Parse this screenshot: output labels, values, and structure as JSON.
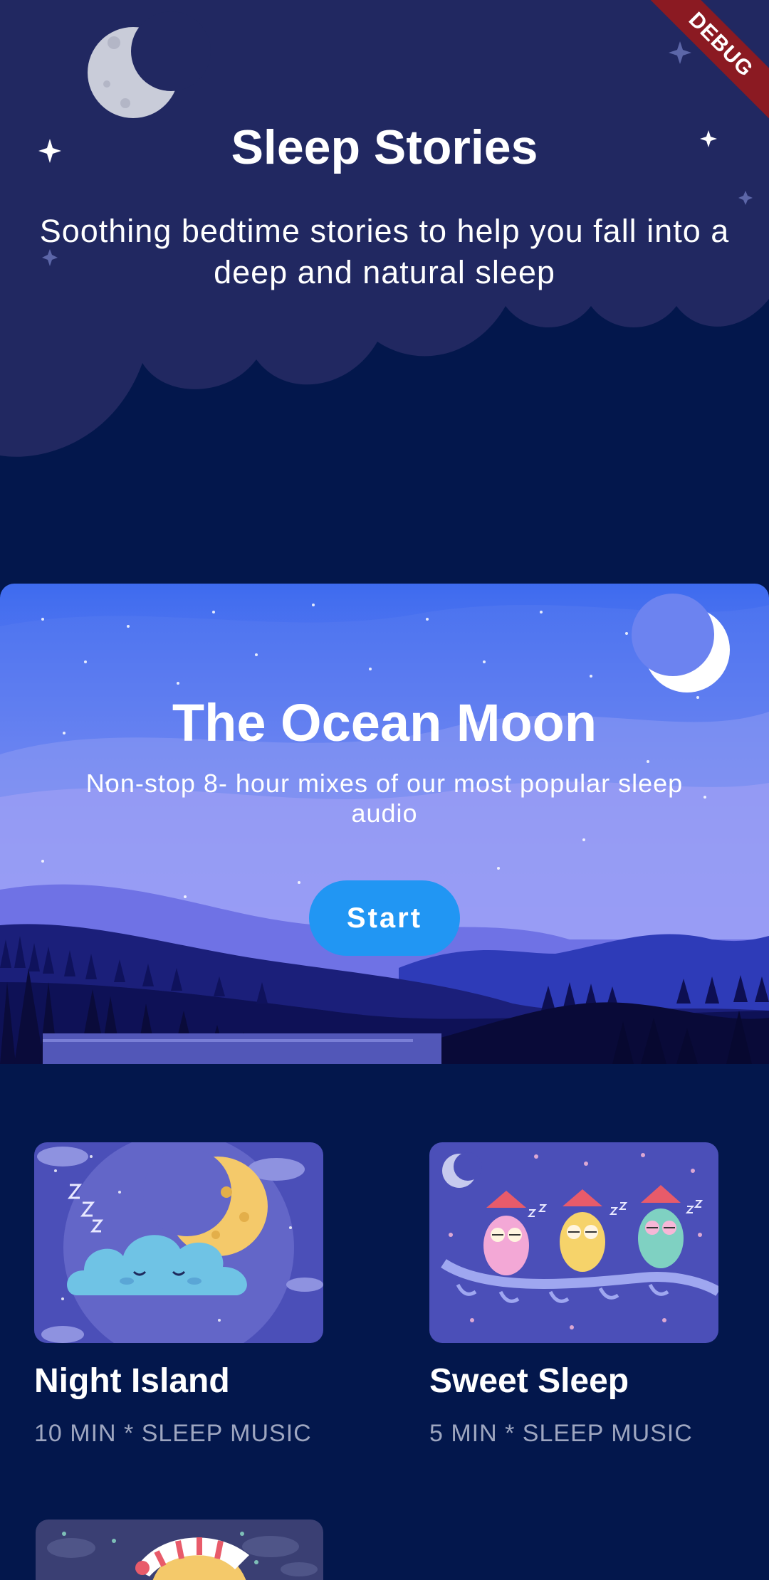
{
  "header": {
    "title": "Sleep Stories",
    "subtitle": "Soothing bedtime stories to help you fall into a deep and natural sleep"
  },
  "debug_banner": "DEBUG",
  "featured": {
    "title": "The Ocean Moon",
    "subtitle": "Non-stop 8- hour mixes of our most popular sleep audio",
    "start_label": "Start"
  },
  "cards": [
    {
      "title": "Night Island",
      "meta": "10 MIN * SLEEP MUSIC"
    },
    {
      "title": "Sweet Sleep",
      "meta": "5 MIN * SLEEP MUSIC"
    }
  ],
  "colors": {
    "background": "#03174C",
    "header": "#212861",
    "accent": "#2196F3",
    "meta_text": "#9EA6C0"
  }
}
